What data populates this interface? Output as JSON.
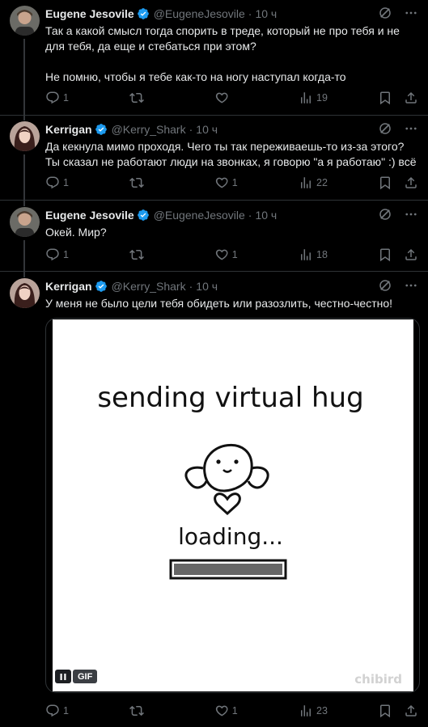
{
  "tweets": [
    {
      "name": "Eugene Jesovile",
      "handle": "@EugeneJesovile",
      "time": "10 ч",
      "text": "Так а какой смысл тогда спорить в треде, который не про тебя и не для тебя, да еще и стебаться при этом?\n\nНе помню, чтобы я тебе как-то на ногу наступал когда-то",
      "replies": "1",
      "retweets": "",
      "likes": "",
      "views": "19"
    },
    {
      "name": "Kerrigan",
      "handle": "@Kerry_Shark",
      "time": "10 ч",
      "text": "Да кекнула мимо проходя. Чего ты так переживаешь-то из-за этого?\nТы сказал не работают люди на звонках, я говорю \"а я работаю\" :) всё",
      "replies": "1",
      "retweets": "",
      "likes": "1",
      "views": "22"
    },
    {
      "name": "Eugene Jesovile",
      "handle": "@EugeneJesovile",
      "time": "10 ч",
      "text": "Окей. Мир?",
      "replies": "1",
      "retweets": "",
      "likes": "1",
      "views": "18"
    },
    {
      "name": "Kerrigan",
      "handle": "@Kerry_Shark",
      "time": "10 ч",
      "text": "У меня не было цели тебя обидеть или разозлить, честно-честно!",
      "replies": "1",
      "retweets": "",
      "likes": "1",
      "views": "23"
    }
  ],
  "gif": {
    "line1": "sending virtual hug",
    "line2": "loading...",
    "watermark": "chibird",
    "badge": "GIF"
  },
  "colors": {
    "verified": "#1d9bf0",
    "muted": "#71767b",
    "divider": "#2f3336"
  },
  "icons": [
    "verified-badge-icon",
    "grok-icon",
    "more-icon",
    "reply-icon",
    "retweet-icon",
    "like-icon",
    "views-icon",
    "bookmark-icon",
    "share-icon",
    "pause-icon"
  ]
}
